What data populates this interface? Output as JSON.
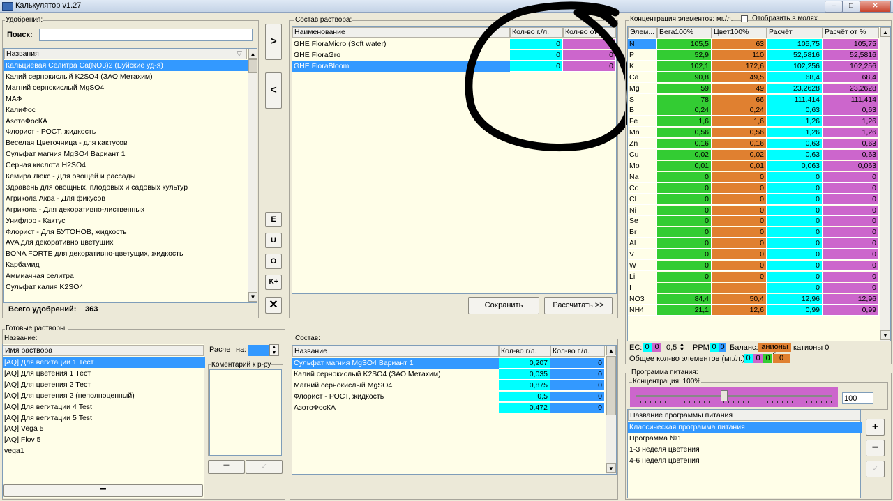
{
  "window": {
    "title": "Калькулятор v1.27"
  },
  "fertilizers": {
    "group_label": "Удобрения:",
    "search_label": "Поиск:",
    "search_value": "",
    "column_header": "Названия",
    "items": [
      "Кальциевая Селитра Ca(NO3)2 (Буйские уд-я)",
      "Калий  сернокислый  K2SO4 (ЗАО Метахим)",
      "Магний сернокислый MgSO4",
      "МАФ",
      "КалиФос",
      "АзотоФосКА",
      "Флорист - РОСТ, жидкость",
      "Веселая Цветочница - для кактусов",
      "Сульфат магния MgSO4 Вариант 1",
      "Серная кислота H2SO4",
      "Кемира Люкс - Для овощей и рассады",
      "Здравень для овощных, плодовых и садовых культур",
      "Агрикола Аква - Для фикусов",
      "Агрикола - Для декоративно-лиственных",
      "Унифлор - Кактус",
      "Флорист - Для БУТОНОВ, жидкость",
      "AVA для декоративно цветущих",
      "BONA FORTE для декоративно-цветущих, жидкость",
      "Карбамид",
      "Аммиачная селитра",
      "Сульфат калия K2SO4"
    ],
    "total_label": "Всего удобрений:",
    "total_value": "363"
  },
  "midbuttons": {
    "add": ">",
    "remove": "<",
    "e": "E",
    "u": "U",
    "o": "O",
    "kplus": "K+",
    "x": "✕"
  },
  "composition": {
    "group_label": "Состав раствора:",
    "columns": [
      "Наименование",
      "Кол-во г./л.",
      "Кол-во от %"
    ],
    "rows": [
      {
        "name": "GHE FloraMicro (Soft water)",
        "qty": "0",
        "pct": "0"
      },
      {
        "name": "GHE FloraGro",
        "qty": "0",
        "pct": "0"
      },
      {
        "name": "GHE FloraBloom",
        "qty": "0",
        "pct": "0"
      }
    ],
    "save_label": "Сохранить",
    "calc_label": "Рассчитать >>"
  },
  "concentration": {
    "group_label": "Концентрация элементов: мг./л.",
    "moles_label": "Отобразить в молях",
    "columns": [
      "Элем...",
      "Вега100%",
      "Цвет100%",
      "Расчёт",
      "Расчёт от %"
    ],
    "rows": [
      {
        "el": "N",
        "a": "105,5",
        "b": "63",
        "c": "105,75",
        "d": "105,75"
      },
      {
        "el": "P",
        "a": "52,9",
        "b": "110",
        "c": "52,5816",
        "d": "52,5816"
      },
      {
        "el": "K",
        "a": "102,1",
        "b": "172,6",
        "c": "102,256",
        "d": "102,256"
      },
      {
        "el": "Ca",
        "a": "90,8",
        "b": "49,5",
        "c": "68,4",
        "d": "68,4"
      },
      {
        "el": "Mg",
        "a": "59",
        "b": "49",
        "c": "23,2628",
        "d": "23,2628"
      },
      {
        "el": "S",
        "a": "78",
        "b": "66",
        "c": "111,414",
        "d": "111,414"
      },
      {
        "el": "B",
        "a": "0,24",
        "b": "0,24",
        "c": "0,63",
        "d": "0,63"
      },
      {
        "el": "Fe",
        "a": "1,6",
        "b": "1,6",
        "c": "1,26",
        "d": "1,26"
      },
      {
        "el": "Mn",
        "a": "0,56",
        "b": "0,56",
        "c": "1,26",
        "d": "1,26"
      },
      {
        "el": "Zn",
        "a": "0,16",
        "b": "0,16",
        "c": "0,63",
        "d": "0,63"
      },
      {
        "el": "Cu",
        "a": "0,02",
        "b": "0,02",
        "c": "0,63",
        "d": "0,63"
      },
      {
        "el": "Mo",
        "a": "0,01",
        "b": "0,01",
        "c": "0,063",
        "d": "0,063"
      },
      {
        "el": "Na",
        "a": "0",
        "b": "0",
        "c": "0",
        "d": "0"
      },
      {
        "el": "Co",
        "a": "0",
        "b": "0",
        "c": "0",
        "d": "0"
      },
      {
        "el": "Cl",
        "a": "0",
        "b": "0",
        "c": "0",
        "d": "0"
      },
      {
        "el": "Ni",
        "a": "0",
        "b": "0",
        "c": "0",
        "d": "0"
      },
      {
        "el": "Se",
        "a": "0",
        "b": "0",
        "c": "0",
        "d": "0"
      },
      {
        "el": "Br",
        "a": "0",
        "b": "0",
        "c": "0",
        "d": "0"
      },
      {
        "el": "Al",
        "a": "0",
        "b": "0",
        "c": "0",
        "d": "0"
      },
      {
        "el": "V",
        "a": "0",
        "b": "0",
        "c": "0",
        "d": "0"
      },
      {
        "el": "W",
        "a": "0",
        "b": "0",
        "c": "0",
        "d": "0"
      },
      {
        "el": "Li",
        "a": "0",
        "b": "0",
        "c": "0",
        "d": "0"
      },
      {
        "el": "I",
        "a": "",
        "b": "",
        "c": "0",
        "d": "0"
      },
      {
        "el": "NO3",
        "a": "84,4",
        "b": "50,4",
        "c": "12,96",
        "d": "12,96"
      },
      {
        "el": "NH4",
        "a": "21,1",
        "b": "12,6",
        "c": "0,99",
        "d": "0,99"
      }
    ],
    "ec_label": "EC:",
    "ec_v1": "0",
    "ec_v2": "0",
    "ec_step": "0,5",
    "ppm_label": "PPM",
    "ppm_v1": "0",
    "ppm_v2": "0",
    "balance_label": "Баланс:",
    "anions_label": "анионы 0",
    "cations_label": "катионы 0",
    "total_label": "Общее кол-во элементов (мг./л.):",
    "total_v1": "0",
    "total_v2": "0",
    "total_v3": "0",
    "total_v4": "0"
  },
  "ready": {
    "group_label": "Готовые растворы:",
    "name_label": "Название:",
    "column_header": "Имя раствора",
    "items": [
      "[AQ] Для вегитации 1 Тест",
      "[AQ] Для цветения 1 Тест",
      "[AQ] Для цветения 2 Тест",
      "[AQ] Для цветения 2 (неполноценный)",
      "[AQ] Для вегитации 4 Test",
      "[AQ] Для вегитации 5 Test",
      "[AQ] Vega 5",
      "[AQ] Flov 5",
      "vega1"
    ],
    "remove_label": "−",
    "calc_on_label": "Расчет на:",
    "comment_label": "Коментарий к р-ру",
    "minus_label": "−",
    "check_label": "✓"
  },
  "sostav": {
    "group_label": "Состав:",
    "columns": [
      "Название",
      "Кол-во г/л.",
      "Кол-во г./л."
    ],
    "rows": [
      {
        "name": "Сульфат магния MgSO4 Вариант 1",
        "a": "0,207",
        "b": "0"
      },
      {
        "name": "Калий  сернокислый  K2SO4 (ЗАО Метахим)",
        "a": "0,035",
        "b": "0"
      },
      {
        "name": "Магний сернокислый MgSO4",
        "a": "0,875",
        "b": "0"
      },
      {
        "name": "Флорист - РОСТ, жидкость",
        "a": "0,5",
        "b": "0"
      },
      {
        "name": "АзотоФосКА",
        "a": "0,472",
        "b": "0"
      }
    ]
  },
  "program": {
    "group_label": "Программа питания:",
    "conc_label": "Концентрация: 100%",
    "conc_value": "100",
    "conc_level": 0.45,
    "column_header": "Название программы питания",
    "items": [
      "Классическая программа питания",
      "Программа №1",
      "1-3 неделя цветения",
      "4-6 неделя цветения"
    ],
    "plus_label": "+",
    "minus_label": "−",
    "check_label": "✓"
  }
}
